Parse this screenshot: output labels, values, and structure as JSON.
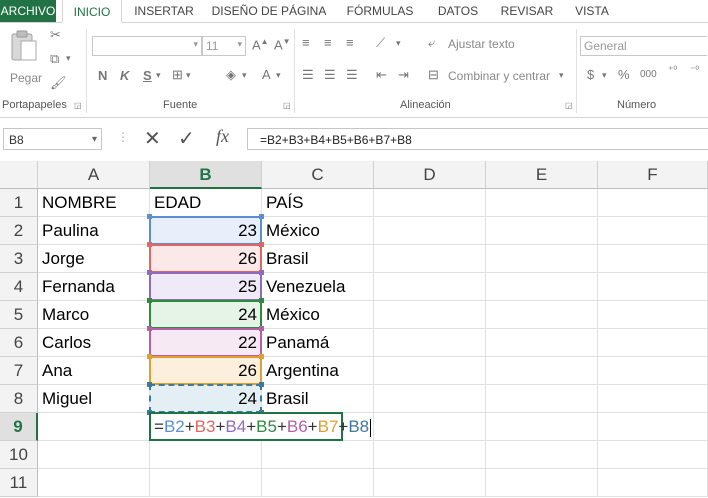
{
  "ribbon_tabs": [
    "ARCHIVO",
    "INICIO",
    "INSERTAR",
    "DISEÑO DE PÁGINA",
    "FÓRMULAS",
    "DATOS",
    "REVISAR",
    "VISTA"
  ],
  "ribbon": {
    "paste": "Pegar",
    "clipboard_group": "Portapapeles",
    "font_group": "Fuente",
    "font_size": "11",
    "bold": "N",
    "italic": "K",
    "underline": "S",
    "align_group": "Alineación",
    "wrap_text": "Ajustar texto",
    "merge_center": "Combinar y centrar",
    "number_group": "Número",
    "number_format": "General",
    "currency": "$",
    "percent": "%",
    "thousands": "000"
  },
  "formula_bar": {
    "name_box": "B8",
    "fx": "fx",
    "formula": "=B2+B3+B4+B5+B6+B7+B8"
  },
  "columns": [
    "A",
    "B",
    "C",
    "D",
    "E",
    "F"
  ],
  "rows": [
    "1",
    "2",
    "3",
    "4",
    "5",
    "6",
    "7",
    "8",
    "9",
    "10",
    "11"
  ],
  "sheet": {
    "headers": [
      "NOMBRE",
      "EDAD",
      "PAÍS"
    ],
    "data": [
      [
        "Paulina",
        "23",
        "México"
      ],
      [
        "Jorge",
        "26",
        "Brasil"
      ],
      [
        "Fernanda",
        "25",
        "Venezuela"
      ],
      [
        "Marco",
        "24",
        "México"
      ],
      [
        "Carlos",
        "22",
        "Panamá"
      ],
      [
        "Ana",
        "26",
        "Argentina"
      ],
      [
        "Miguel",
        "24",
        "Brasil"
      ]
    ]
  },
  "edit_formula_parts": [
    {
      "text": "=",
      "color": "#333333"
    },
    {
      "text": "B2",
      "color": "#5b8fd1"
    },
    {
      "text": "+",
      "color": "#333333"
    },
    {
      "text": "B3",
      "color": "#e06666"
    },
    {
      "text": "+",
      "color": "#333333"
    },
    {
      "text": "B4",
      "color": "#8e6bbf"
    },
    {
      "text": "+",
      "color": "#333333"
    },
    {
      "text": "B5",
      "color": "#2e8b3e"
    },
    {
      "text": "+",
      "color": "#333333"
    },
    {
      "text": "B6",
      "color": "#b45fa8"
    },
    {
      "text": "+",
      "color": "#333333"
    },
    {
      "text": "B7",
      "color": "#e0a030"
    },
    {
      "text": "+",
      "color": "#333333"
    },
    {
      "text": "B8",
      "color": "#3b7a9e"
    }
  ],
  "ref_colors": [
    "#5b8fd1",
    "#e06666",
    "#8e6bbf",
    "#2e8b3e",
    "#b45fa8",
    "#e0a030",
    "#3b7a9e"
  ],
  "ref_fills": [
    "#e8eefa",
    "#fbe9e9",
    "#efeaf7",
    "#e6f3e7",
    "#f6e9f4",
    "#fcf0dc",
    "#e4eff5"
  ],
  "accent": "#217346"
}
